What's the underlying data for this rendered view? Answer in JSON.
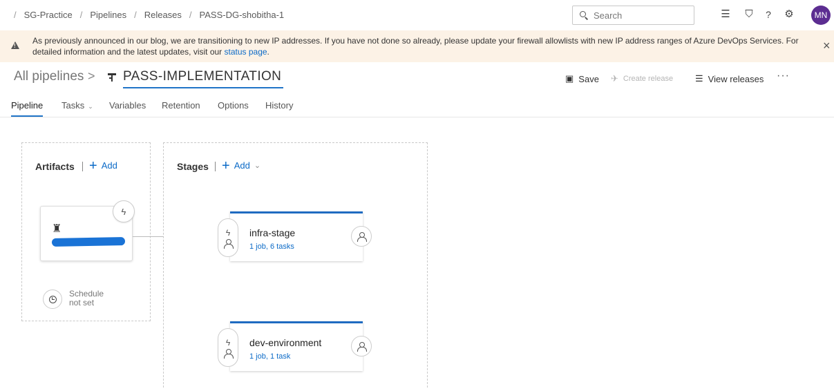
{
  "breadcrumb": [
    "SG-Practice",
    "Pipelines",
    "Releases",
    "PASS-DG-shobitha-1"
  ],
  "search": {
    "placeholder": "Search"
  },
  "user": {
    "initials": "MN",
    "color": "#5c2d91"
  },
  "banner": {
    "text": "As previously announced in our blog, we are transitioning to new IP addresses. If you have not done so already, please update your firewall allowlists with new IP address ranges of Azure DevOps Services. For detailed information and the latest updates, visit our ",
    "link": "status page",
    "suffix": ".",
    "close": "×"
  },
  "title": {
    "all_pipelines": "All pipelines",
    "separator": ">",
    "pipeline_name": "PASS-IMPLEMENTATION"
  },
  "actions": {
    "save": "Save",
    "create_release": "Create release",
    "view_releases": "View releases",
    "more": "···"
  },
  "tabs": [
    {
      "label": "Pipeline",
      "active": true
    },
    {
      "label": "Tasks",
      "has_dropdown": true
    },
    {
      "label": "Variables"
    },
    {
      "label": "Retention"
    },
    {
      "label": "Options"
    },
    {
      "label": "History"
    }
  ],
  "artifacts": {
    "title": "Artifacts",
    "add_label": "Add",
    "schedule_line1": "Schedule",
    "schedule_line2": "not set"
  },
  "stages": {
    "title": "Stages",
    "add_label": "Add",
    "items": [
      {
        "name": "infra-stage",
        "info": "1 job, 6 tasks"
      },
      {
        "name": "dev-environment",
        "info": "1 job, 1 task"
      }
    ]
  },
  "colors": {
    "accent": "#1f74c7",
    "link": "#0b6ac7",
    "banner_bg": "#fcf2e6"
  }
}
